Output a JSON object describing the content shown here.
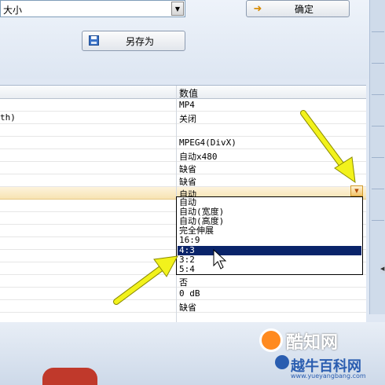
{
  "toolbar": {
    "size_combo_value": "大小",
    "ok_label": "确定",
    "save_as_label": "另存为"
  },
  "grid": {
    "header_value": "数值",
    "rows": [
      {
        "name": "",
        "value": "MP4"
      },
      {
        "name": "th)",
        "value": "关闭"
      },
      {
        "name": "",
        "value": ""
      },
      {
        "name": "",
        "value": "MPEG4(DivX)"
      },
      {
        "name": "",
        "value": "自动x480"
      },
      {
        "name": "",
        "value": "缺省"
      },
      {
        "name": "",
        "value": "缺省"
      },
      {
        "name": "",
        "value": "自动"
      }
    ],
    "rows_below": [
      {
        "name": "",
        "value": "否"
      },
      {
        "name": "",
        "value": "0 dB"
      },
      {
        "name": "",
        "value": "缺省"
      }
    ]
  },
  "dropdown": {
    "options": [
      "自动",
      "自动(宽度)",
      "自动(高度)",
      "完全伸展",
      "16:9",
      "4:3",
      "3:2",
      "5:4"
    ],
    "highlighted": "4:3"
  },
  "watermark": {
    "brand": "酷知网",
    "brand2": "越牛百科网",
    "url": "www.yueyangbang.com"
  },
  "colors": {
    "arrow": "#f2f21c",
    "highlight": "#0a246a",
    "selected_row": "#f7e3b2"
  }
}
